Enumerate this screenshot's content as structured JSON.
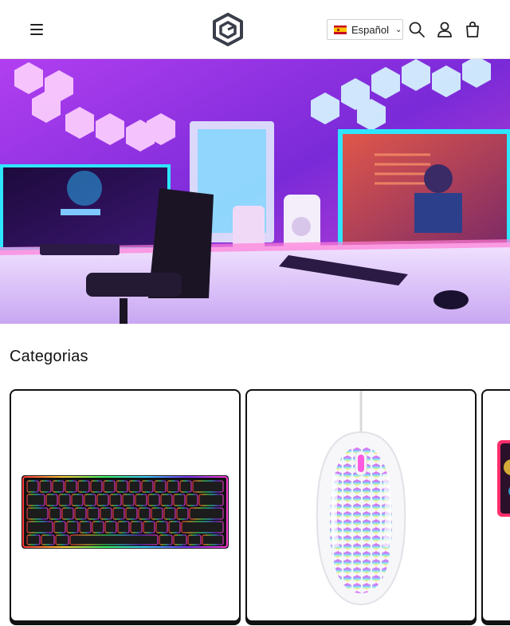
{
  "header": {
    "language": {
      "label": "Español",
      "flag": "spain-flag-icon"
    },
    "icons": [
      "menu-icon",
      "brand-logo",
      "search-icon",
      "account-icon",
      "cart-icon"
    ]
  },
  "hero": {
    "image": "gaming-setup-neon-photo"
  },
  "categories": {
    "title": "Categorias",
    "items": [
      {
        "image": "rgb-keyboard-photo"
      },
      {
        "image": "rgb-mouse-photo"
      },
      {
        "image": "mousepad-photo"
      }
    ]
  }
}
